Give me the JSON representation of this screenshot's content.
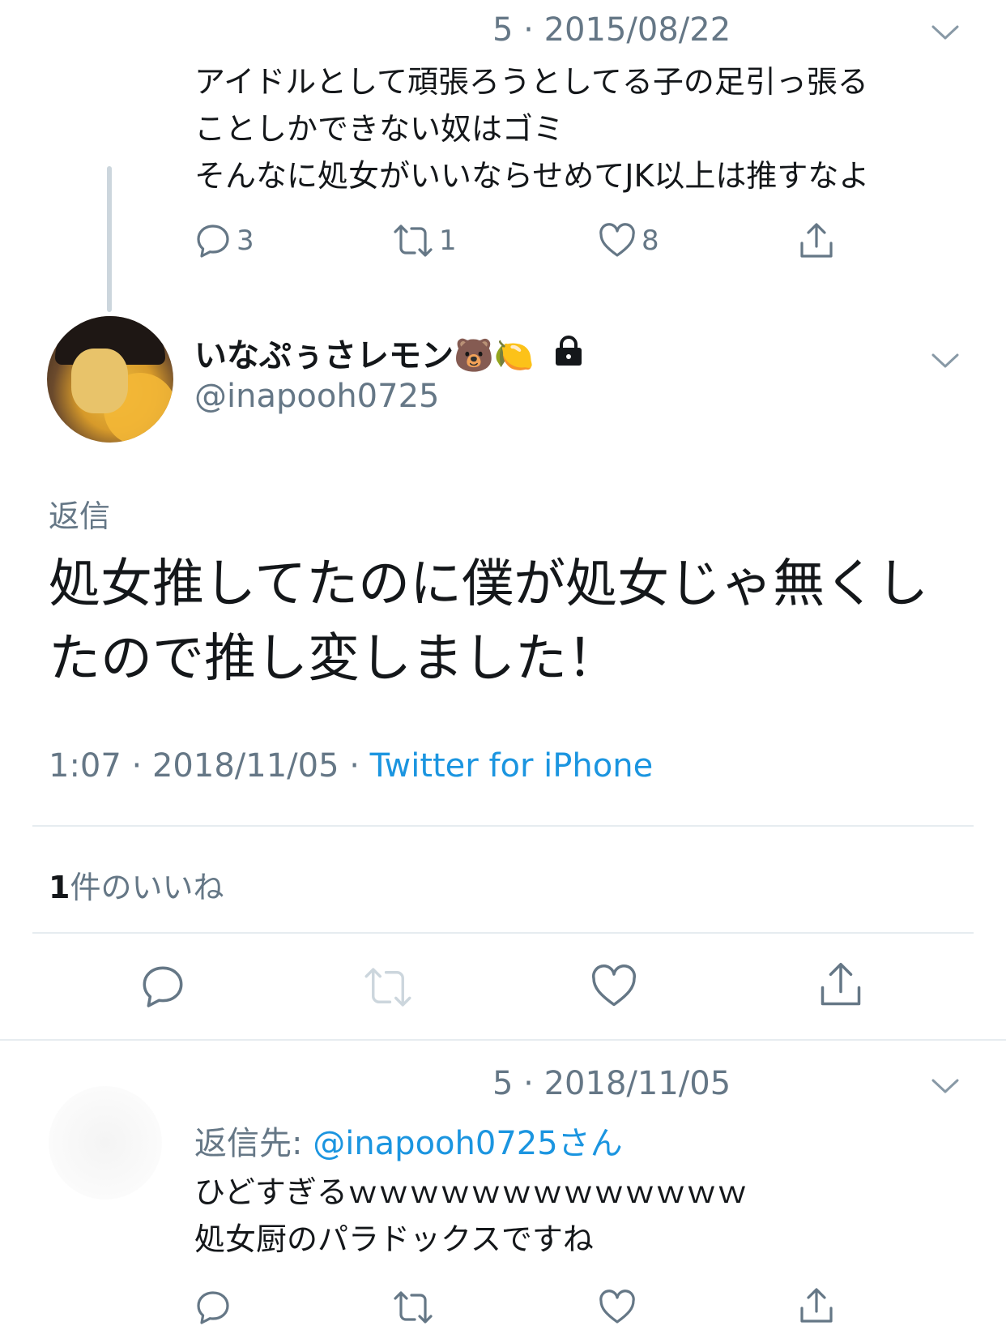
{
  "prev_tweet": {
    "meta": "5 · 2015/08/22",
    "text_lines": [
      "アイドルとして頑張ろうとしてる子の足引っ張る",
      "ことしかできない奴はゴミ",
      "そんなに処女がいいならせめてJK以上は推すなよ"
    ],
    "replies": "3",
    "retweets": "1",
    "likes": "8"
  },
  "main_tweet": {
    "display_name": "いなぷぅさレモン🐻🍋",
    "handle": "@inapooh0725",
    "reply_to_label": "返信",
    "text_lines": [
      "処女推してたのに僕が処女じゃ無くし",
      "たので推し変しました！"
    ],
    "time": "1:07 · 2018/11/05 · ",
    "source": "Twitter for iPhone",
    "likes_count": "1",
    "likes_label": "件のいいね"
  },
  "reply_tweet": {
    "meta": "5 · 2018/11/05",
    "reply_to_prefix": "返信先: ",
    "reply_to_handle": "@inapooh0725さん",
    "text_lines": [
      "ひどすぎるｗｗｗｗｗｗｗｗｗｗｗｗｗ",
      "処女厨のパラドックスですね"
    ]
  },
  "colors": {
    "accent": "#1b95e0",
    "muted": "#657786",
    "icon": "#657786",
    "divider": "#e6ecf0"
  },
  "icons": [
    "reply-icon",
    "retweet-icon",
    "like-icon",
    "share-icon",
    "chevron-down-icon",
    "lock-icon"
  ]
}
